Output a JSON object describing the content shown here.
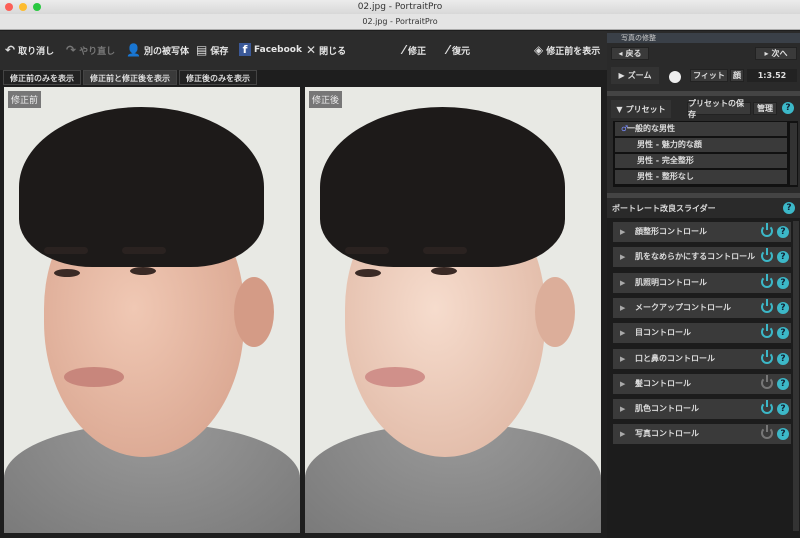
{
  "window": {
    "title": "02.jpg - PortraitPro",
    "subtitle": "02.jpg - PortraitPro"
  },
  "toolbar": {
    "undo": "取り消し",
    "redo": "やり直し",
    "other_subject": "別の被写体",
    "save": "保存",
    "facebook": "Facebook",
    "close": "閉じる",
    "fix": "修正",
    "restore": "復元",
    "show_before": "修正前を表示"
  },
  "tabs": [
    "修正前のみを表示",
    "修正前と修正後を表示",
    "修正後のみを表示"
  ],
  "photos": {
    "before": "修正前",
    "after": "修正後"
  },
  "panel": {
    "header": "写真の修整",
    "back": "戻る",
    "next": "次へ",
    "zoom": "ズーム",
    "fit": "フィット",
    "face": "顔",
    "zoom_value": "1:3.52",
    "preset_label": "プリセット",
    "preset_save": "プリセットの保存",
    "manage": "管理",
    "presets": [
      "一般的な男性",
      "男性 - 魅力的な顔",
      "男性 - 完全整形",
      "男性 - 整形なし"
    ],
    "sliders_title": "ポートレート改良スライダー",
    "controls": [
      {
        "label": "顔整形コントロール",
        "on": true
      },
      {
        "label": "肌をなめらかにするコントロール",
        "on": true
      },
      {
        "label": "肌照明コントロール",
        "on": true
      },
      {
        "label": "メークアップコントロール",
        "on": true
      },
      {
        "label": "目コントロール",
        "on": true
      },
      {
        "label": "口と鼻のコントロール",
        "on": true
      },
      {
        "label": "髪コントロール",
        "on": false
      },
      {
        "label": "肌色コントロール",
        "on": true
      },
      {
        "label": "写真コントロール",
        "on": false
      }
    ],
    "help": "?"
  },
  "colors": {
    "accent": "#3cb8c8"
  }
}
